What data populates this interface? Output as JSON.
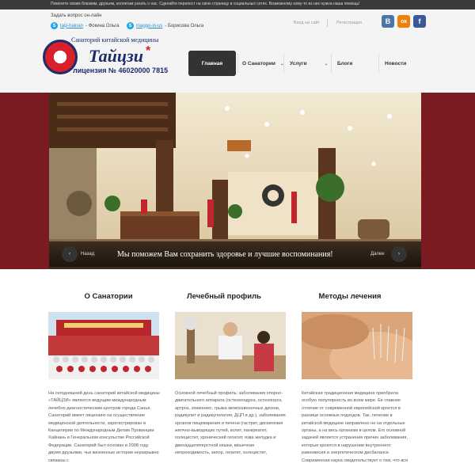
{
  "topbar": {
    "text": "Помогите своим близким, друзьям, коллегам узнать о нас. Сделайте перепост на свою страницу в социальных сетях. Возможному кому-то из них нужна наша помощь!"
  },
  "contact": {
    "title": "Задать вопрос он-лайн",
    "skype1": {
      "handle": "taiji-hainan",
      "name": "- Фокина Ольга"
    },
    "skype2": {
      "handle": "maggo-in-us",
      "name": "- Борисова Ольга"
    }
  },
  "auth": {
    "login": "Вход на сайт",
    "register": "Регистрация"
  },
  "social": [
    {
      "name": "vk",
      "glyph": "В",
      "color": "#4a76a8"
    },
    {
      "name": "ok",
      "glyph": "ок",
      "color": "#ee8208"
    },
    {
      "name": "fb",
      "glyph": "f",
      "color": "#3b5998"
    }
  ],
  "logo": {
    "top": "Санаторий китайской медицины",
    "main": "Тайцзи",
    "star": "*",
    "license": "лицензия № 46020000 7815"
  },
  "nav": [
    {
      "label": "Главная"
    },
    {
      "label": "О Санатории"
    },
    {
      "label": "Услуги"
    },
    {
      "label": "Блоги"
    },
    {
      "label": "Новости"
    }
  ],
  "hero": {
    "caption": "Мы поможем Вам сохранить здоровье и лучшие воспоминания!",
    "prev": "Назад",
    "next": "Далее"
  },
  "columns": [
    {
      "title": "О Санатории",
      "text": "На сегодняшний день санаторий китайской медицины «ТАЙЦЗИ» является ведущим международным лечебно-диагностическим центром города Санья. Санаторий имеет лицензию на осуществление медицинской деятельности, зарегистрирован в Канцелярии по Международным Делам Провинции Хайнань и Генеральном консульстве Российской Федерации. Санаторий был основан в 2008 году двумя друзьями, чьи жизненные истории неразрывно связаны с"
    },
    {
      "title": "Лечебный профиль",
      "text": "Основной лечебный профиль: заболевания опорно-двигательного аппарата (остеохондроз, остеопороз, артроз, эпиконикс, грыжа межпозвоночных дисков, радикулит и радикулопатия, ДЦП и др.), заболевания органов пищеварения и печени (гастрит, дискинезия желчно-выводящих путей, колит, панкреатит, холецистит, хронический гепатит, язва желудка и двенадцатиперстной кишки, кишечная непроходимость, запор, гепатит, холецистит,"
    },
    {
      "title": "Методы лечения",
      "text": "Китайская традиционная медицина приобрела особую популярность во всем мире. Ее главное отличие от современной европейской кроется в разнице основных подходов. Так, лечение в китайской медицине направлено не на отдельные органы, а на весь организм в целом. Его основной задачей является устранение причин заболевания, которые кроются в нарушении внутреннего равновесия и энергетическом дисбалансе. Современная наука свидетельствует о том, что вся"
    }
  ]
}
